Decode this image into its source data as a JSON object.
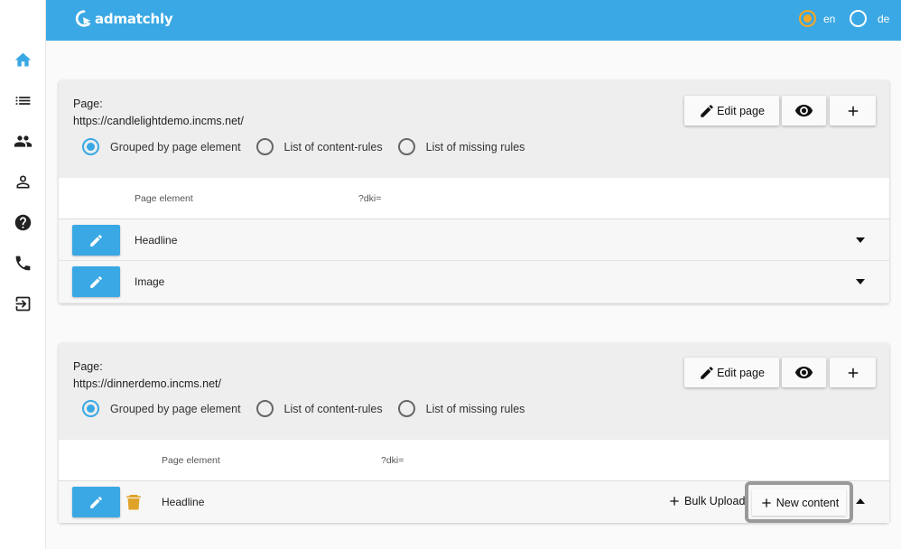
{
  "app": {
    "name": "admatchly"
  },
  "header": {
    "languages": [
      {
        "code": "en",
        "selected": true
      },
      {
        "code": "de",
        "selected": false
      }
    ],
    "accent_color": "#3aa8e4",
    "selected_color": "#f5a623"
  },
  "sidebar": {
    "items": [
      {
        "icon": "home-icon",
        "active": true
      },
      {
        "icon": "list-icon",
        "active": false
      },
      {
        "icon": "group-icon",
        "active": false
      },
      {
        "icon": "person-icon",
        "active": false
      },
      {
        "icon": "help-icon",
        "active": false
      },
      {
        "icon": "phone-icon",
        "active": false
      },
      {
        "icon": "logout-icon",
        "active": false
      }
    ]
  },
  "pages": [
    {
      "label": "Page:",
      "url": "https://candlelightdemo.incms.net/",
      "view_options": [
        {
          "label": "Grouped by page element",
          "selected": true
        },
        {
          "label": "List of content-rules",
          "selected": false
        },
        {
          "label": "List of missing rules",
          "selected": false
        }
      ],
      "actions": {
        "edit_label": "Edit page"
      },
      "table": {
        "col_element": "Page element",
        "col_dki": "?dki=",
        "rows": [
          {
            "name": "Headline"
          },
          {
            "name": "Image"
          }
        ]
      }
    },
    {
      "label": "Page:",
      "url": "https://dinnerdemo.incms.net/",
      "view_options": [
        {
          "label": "Grouped by page element",
          "selected": true
        },
        {
          "label": "List of content-rules",
          "selected": false
        },
        {
          "label": "List of missing rules",
          "selected": false
        }
      ],
      "actions": {
        "edit_label": "Edit page"
      },
      "table": {
        "col_element": "Page element",
        "col_dki": "?dki=",
        "rows": [
          {
            "name": "Headline",
            "bulk_upload_label": "Bulk Upload",
            "new_content_label": "New content"
          }
        ]
      }
    }
  ]
}
